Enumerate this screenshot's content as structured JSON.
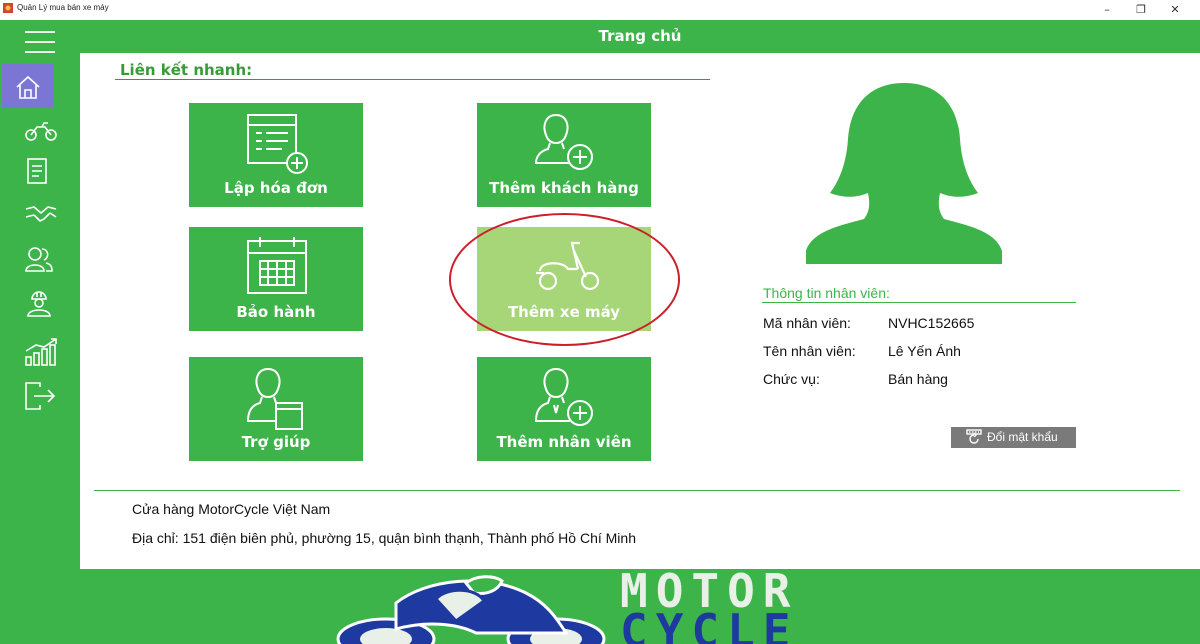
{
  "window": {
    "title": "Quản Lý mua bán xe máy",
    "minimize": "–",
    "maximize": "❐",
    "close": "✕"
  },
  "header": {
    "title": "Trang chủ"
  },
  "sidebar": {
    "items": [
      {
        "icon": "home-icon",
        "active": true
      },
      {
        "icon": "motorbike-icon"
      },
      {
        "icon": "invoice-icon"
      },
      {
        "icon": "handshake-icon"
      },
      {
        "icon": "customers-icon"
      },
      {
        "icon": "worker-icon"
      },
      {
        "icon": "chart-icon"
      },
      {
        "icon": "logout-icon"
      }
    ]
  },
  "quick_links": {
    "title": "Liên kết nhanh:",
    "tiles": [
      {
        "label": "Lập hóa đơn",
        "icon": "invoice-add-icon"
      },
      {
        "label": "Thêm khách hàng",
        "icon": "user-add-icon"
      },
      {
        "label": "Bảo hành",
        "icon": "calendar-icon"
      },
      {
        "label": "Thêm xe máy",
        "icon": "scooter-icon",
        "state": "hover"
      },
      {
        "label": "Trợ giúp",
        "icon": "help-icon"
      },
      {
        "label": "Thêm nhân viên",
        "icon": "employee-add-icon"
      }
    ]
  },
  "employee": {
    "section_title": "Thông tin nhân viên:",
    "id_label": "Mã nhân viên:",
    "id_value": "NVHC152665",
    "name_label": "Tên nhân viên:",
    "name_value": "Lê Yến Ánh",
    "role_label": "Chức vụ:",
    "role_value": "Bán hàng",
    "change_password": "Đổi mật khẩu"
  },
  "store": {
    "name": "Cửa hàng MotorCycle Việt Nam",
    "address": "Địa chỉ: 151 điện biên phủ, phường 15, quận bình thạnh, Thành phố Hồ Chí Minh"
  },
  "banner": {
    "line1": "MOTOR",
    "line2": "CYCLE"
  },
  "colors": {
    "primary": "#3cb44a",
    "active_nav": "#7b75d3",
    "hover_tile": "#a6d677",
    "highlight": "#cc1f2a"
  }
}
